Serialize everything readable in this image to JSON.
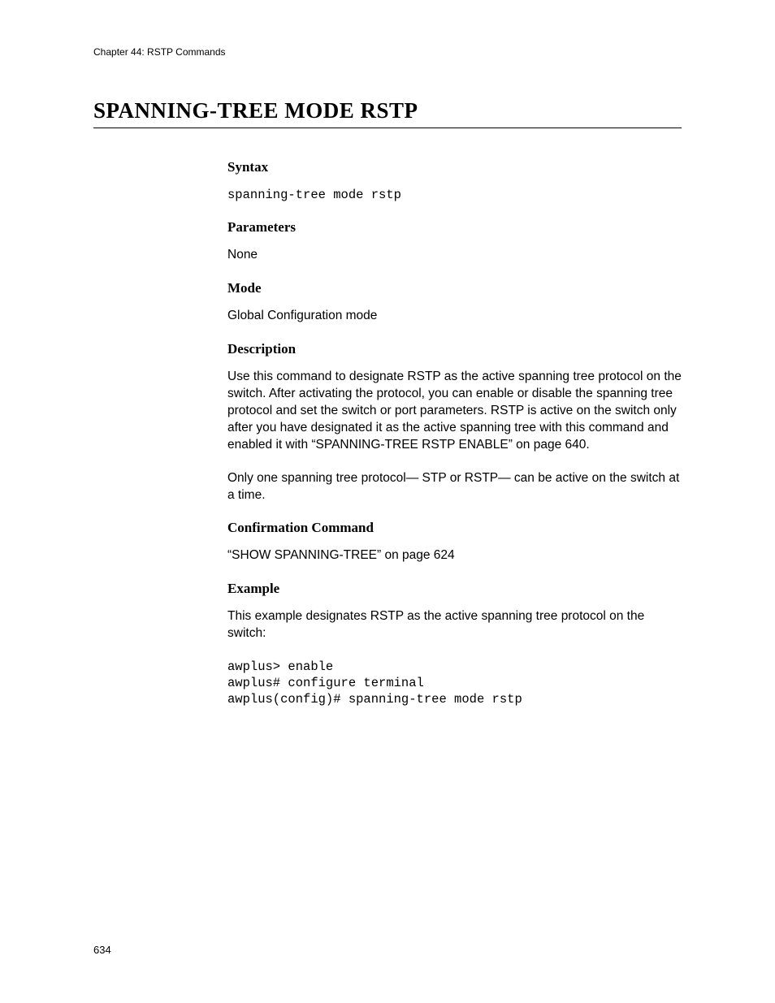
{
  "header": {
    "chapter": "Chapter 44: RSTP Commands"
  },
  "title": "SPANNING-TREE MODE RSTP",
  "sections": {
    "syntax": {
      "heading": "Syntax",
      "code": "spanning-tree mode rstp"
    },
    "parameters": {
      "heading": "Parameters",
      "text": "None"
    },
    "mode": {
      "heading": "Mode",
      "text": "Global Configuration mode"
    },
    "description": {
      "heading": "Description",
      "para1": "Use this command to designate RSTP as the active spanning tree protocol on the switch. After activating the protocol, you can enable or disable the spanning tree protocol and set the switch or port parameters. RSTP is active on the switch only after you have designated it as the active spanning tree with this command and enabled it with “SPANNING-TREE RSTP ENABLE” on page 640.",
      "para2": "Only one spanning tree protocol— STP or RSTP— can be active on the switch at a time."
    },
    "confirmation": {
      "heading": "Confirmation Command",
      "text": "“SHOW SPANNING-TREE” on page 624"
    },
    "example": {
      "heading": "Example",
      "intro": "This example designates RSTP as the active spanning tree protocol on the switch:",
      "code": "awplus> enable\nawplus# configure terminal\nawplus(config)# spanning-tree mode rstp"
    }
  },
  "pageNumber": "634"
}
